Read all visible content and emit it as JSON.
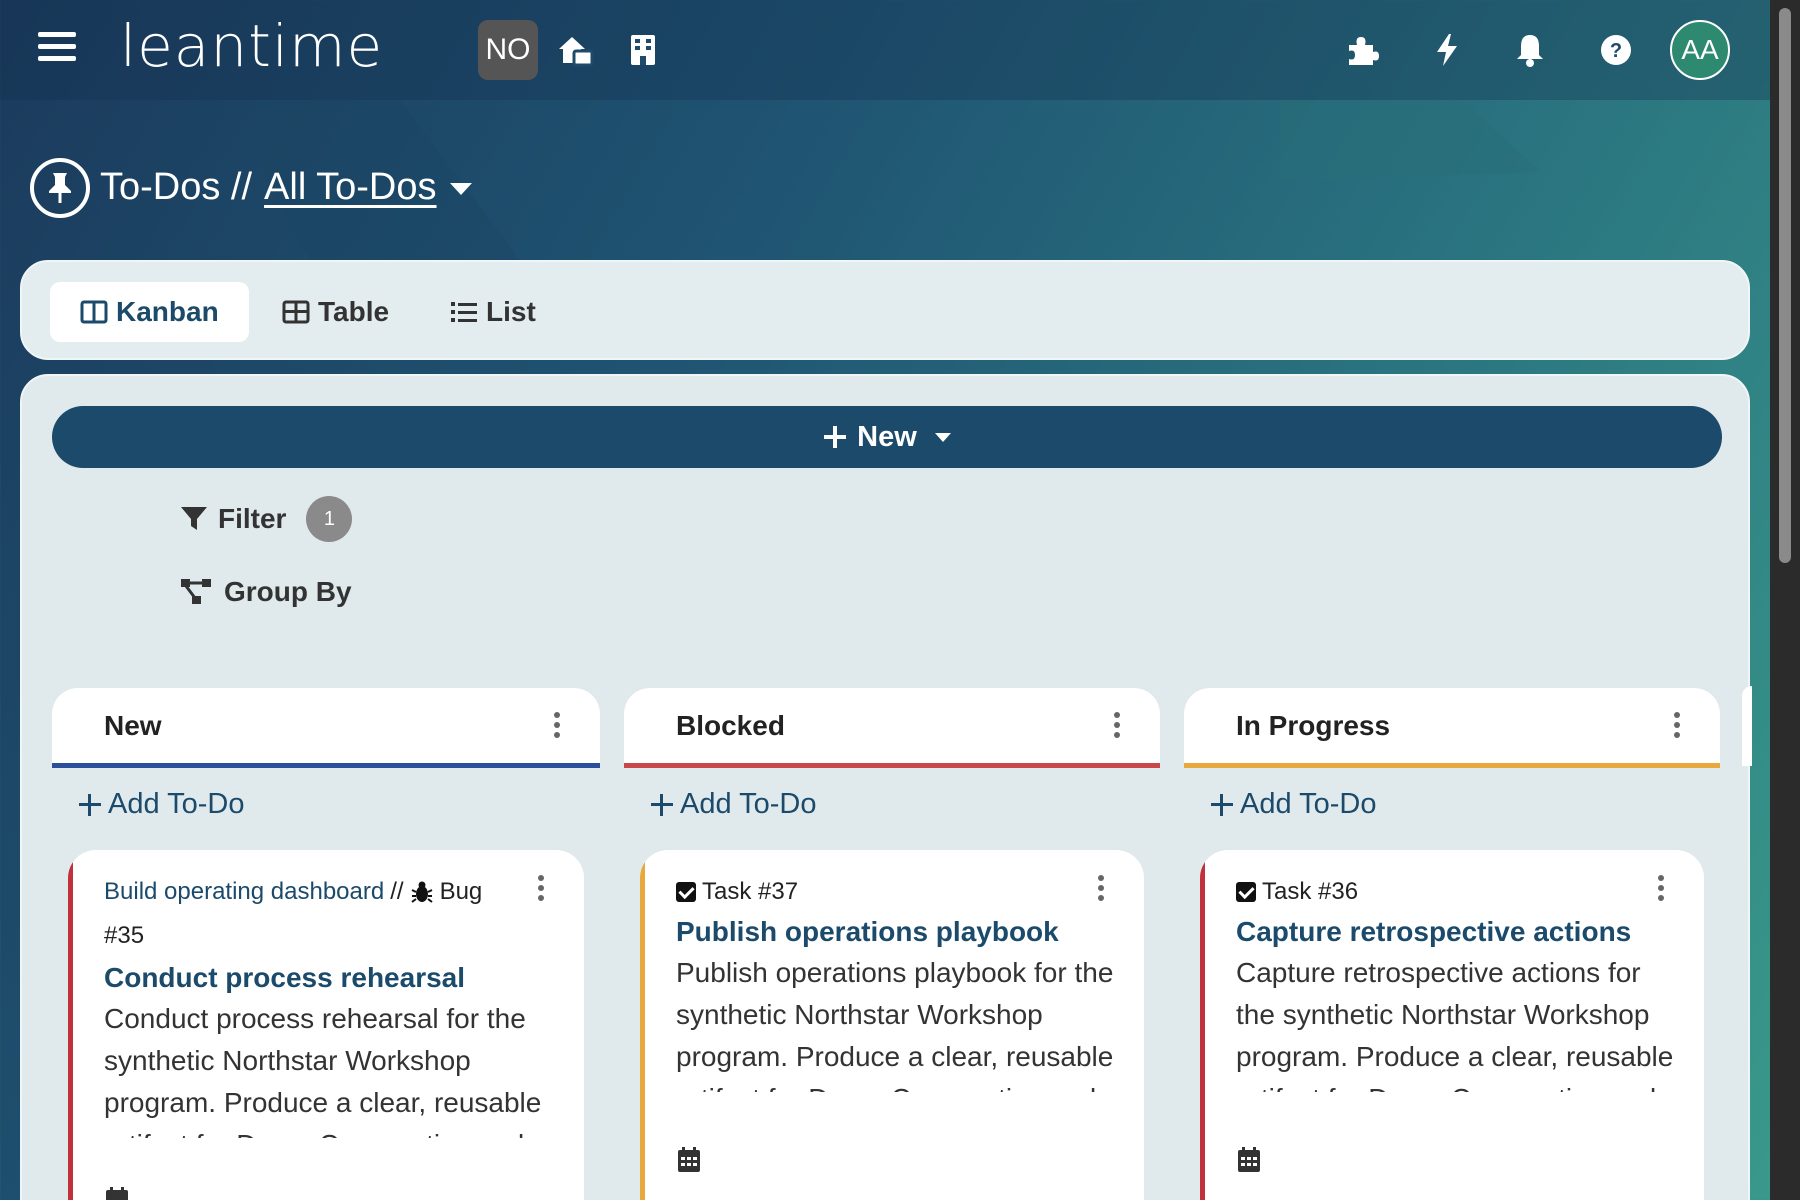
{
  "header": {
    "logo": "leantime",
    "project_initials": "NO",
    "avatar_initials": "AA",
    "icons": [
      "home-icon",
      "building-icon",
      "puzzle-icon",
      "lightning-icon",
      "bell-icon",
      "help-icon"
    ]
  },
  "page": {
    "section": "To-Dos //",
    "view_name": "All To-Dos"
  },
  "views": {
    "kanban": "Kanban",
    "table": "Table",
    "list": "List",
    "active": "Kanban"
  },
  "toolbar": {
    "new_label": "New",
    "filter_label": "Filter",
    "filter_count": "1",
    "groupby_label": "Group By"
  },
  "columns": [
    {
      "name": "New",
      "color": "#2b4f9a",
      "add_label": "Add To-Do",
      "card": {
        "accent": "#c0313c",
        "project": "Build operating dashboard",
        "separator": "//",
        "type": "Bug",
        "number": "#35",
        "title": "Conduct process rehearsal",
        "description": "Conduct process rehearsal for the synthetic Northstar Workshop program. Produce a clear, reusable artifact for Demo Cooperative and"
      }
    },
    {
      "name": "Blocked",
      "color": "#c9484a",
      "add_label": "Add To-Do",
      "card": {
        "accent": "#e8a93c",
        "type": "Task #37",
        "title": "Publish operations playbook",
        "description": "Publish operations playbook for the synthetic Northstar Workshop program. Produce a clear, reusable artifact for Demo Cooperative and"
      }
    },
    {
      "name": "In Progress",
      "color": "#e8a93c",
      "add_label": "Add To-Do",
      "card": {
        "accent": "#c0313c",
        "type": "Task #36",
        "title": "Capture retrospective actions",
        "description": "Capture retrospective actions for the synthetic Northstar Workshop program. Produce a clear, reusable artifact for Demo Cooperative and"
      }
    }
  ]
}
